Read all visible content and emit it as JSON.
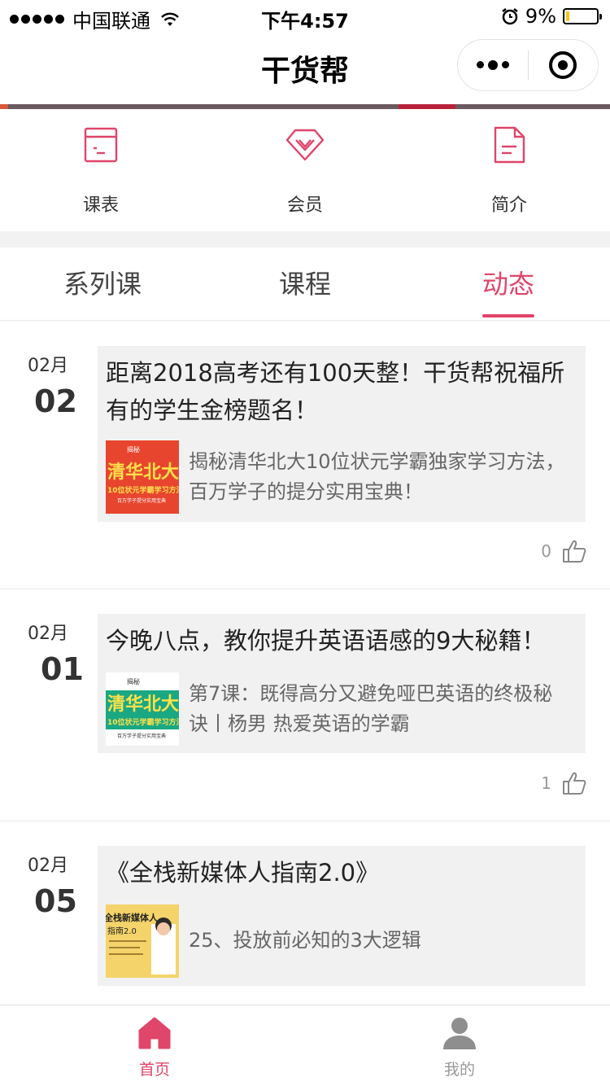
{
  "status_bar": {
    "carrier": "中国联通",
    "time": "下午4:57",
    "battery": "9%"
  },
  "nav": {
    "title": "干货帮"
  },
  "quick_menu": [
    {
      "label": "课表",
      "icon": "schedule-icon"
    },
    {
      "label": "会员",
      "icon": "vip-diamond-icon"
    },
    {
      "label": "简介",
      "icon": "document-icon"
    }
  ],
  "tabs": [
    {
      "label": "系列课",
      "active": false
    },
    {
      "label": "课程",
      "active": false
    },
    {
      "label": "动态",
      "active": true
    }
  ],
  "colors": {
    "accent": "#e0456a"
  },
  "feed": [
    {
      "month": "02月",
      "day": "02",
      "title": "距离2018高考还有100天整！干货帮祝福所有的学生金榜题名！",
      "thumb_text": {
        "tag": "揭秘",
        "main": "清华北大",
        "sub": "10位状元学霸学习方法",
        "foot": "百万学子提分实用宝典"
      },
      "desc": "揭秘清华北大10位状元学霸独家学习方法，百万学子的提分实用宝典！",
      "likes": "0"
    },
    {
      "month": "02月",
      "day": "01",
      "title": "今晚八点，教你提升英语语感的9大秘籍！",
      "thumb_text": {
        "tag": "揭秘",
        "main": "清华北大",
        "sub": "10位状元学霸学习方法",
        "foot": "百万学子提分实用宝典"
      },
      "desc": "第7课：既得高分又避免哑巴英语的终极秘诀丨杨男 热爱英语的学霸",
      "likes": "1"
    },
    {
      "month": "02月",
      "day": "05",
      "title": "《全栈新媒体人指南2.0》",
      "thumb_text": {
        "main": "全栈新媒体人",
        "sub": "指南2.0"
      },
      "desc": "25、投放前必知的3大逻辑",
      "likes": ""
    }
  ],
  "tabbar": [
    {
      "label": "首页",
      "icon": "home-icon",
      "active": true
    },
    {
      "label": "我的",
      "icon": "user-icon",
      "active": false
    }
  ]
}
